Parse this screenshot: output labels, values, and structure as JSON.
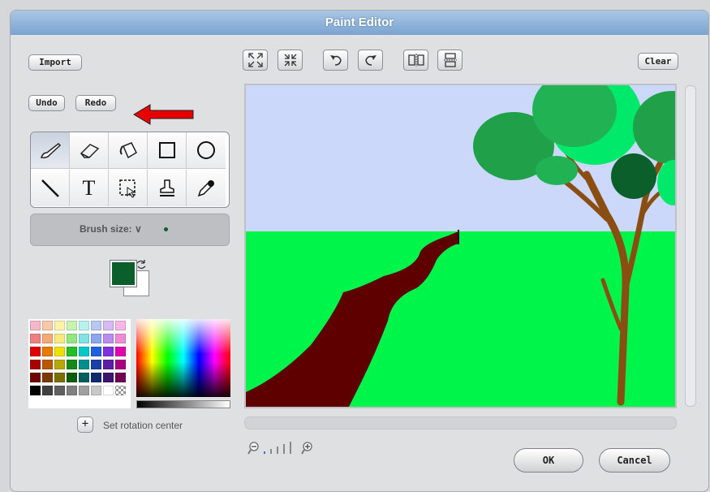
{
  "window": {
    "title": "Paint Editor"
  },
  "left_panel": {
    "import_label": "Import",
    "undo_label": "Undo",
    "redo_label": "Redo",
    "brush_size_label": "Brush size: ∨",
    "set_rotation_center_label": "Set rotation center",
    "plus_glyph": "+"
  },
  "tools": [
    "paintbrush-icon",
    "eraser-icon",
    "fill-bucket-icon",
    "rectangle-icon",
    "ellipse-icon",
    "line-icon",
    "text-icon",
    "select-icon",
    "stamp-icon",
    "eyedropper-icon"
  ],
  "toolbar": {
    "icons": [
      "zoom-out-to-fit-icon",
      "shrink-icon",
      "undo-arrow-icon",
      "redo-arrow-icon",
      "flip-horizontal-icon",
      "flip-vertical-icon"
    ],
    "clear_label": "Clear",
    "text_tool_glyph": "T"
  },
  "colors": {
    "foreground": "#0b5f2a",
    "background": "#ffffff",
    "sky": "#cbd8fa",
    "grass": "#00f54b",
    "path": "#5e0000",
    "trunk": "#8b4e12",
    "arrow": "#e60000"
  },
  "palette": [
    [
      "#f6b8c7",
      "#f8c9a8",
      "#fbf3a8",
      "#c6f3b0",
      "#b8f2f0",
      "#b8c8f5",
      "#d8b8f5",
      "#f5b8e6"
    ],
    [
      "#f08080",
      "#f4a979",
      "#f8ea7a",
      "#93e77f",
      "#80e4e4",
      "#8da6f0",
      "#b98cf0",
      "#f08ad4"
    ],
    [
      "#e00000",
      "#e87a00",
      "#f0e000",
      "#22c022",
      "#00c8c8",
      "#2060e0",
      "#8030e0",
      "#e000b0"
    ],
    [
      "#a80000",
      "#b85800",
      "#b8a800",
      "#168a16",
      "#008e8e",
      "#1840a8",
      "#5a1ea8",
      "#a80080"
    ],
    [
      "#700000",
      "#7a3a00",
      "#7a7000",
      "#0c5c0c",
      "#005e5e",
      "#102a70",
      "#3c1470",
      "#700054"
    ],
    [
      "#000000",
      "#404040",
      "#606060",
      "#808080",
      "#a0a0a0",
      "#c8c8c8",
      "#ffffff",
      "checker"
    ]
  ],
  "zoom": {
    "level_bars": 5,
    "selected_bar": 1
  },
  "buttons": {
    "ok_label": "OK",
    "cancel_label": "Cancel"
  }
}
